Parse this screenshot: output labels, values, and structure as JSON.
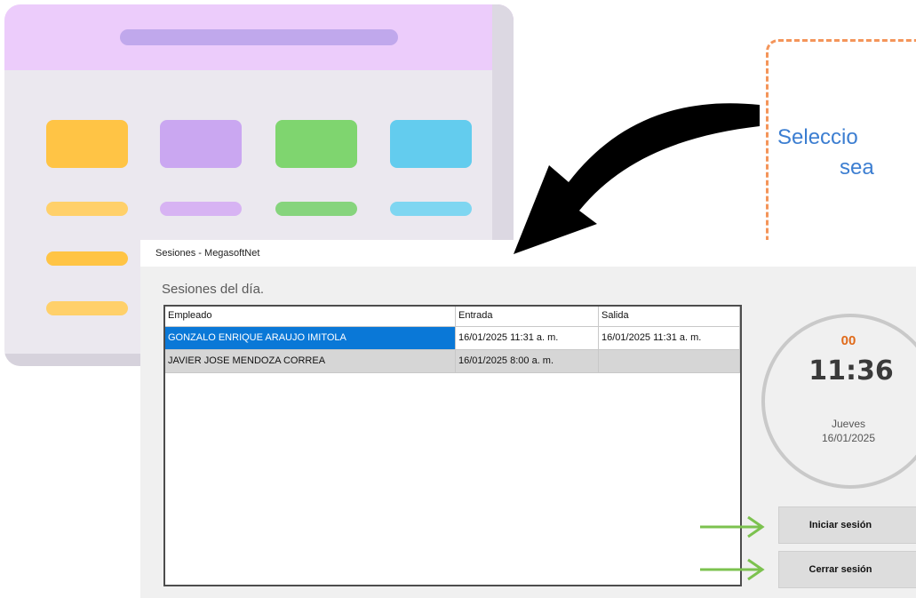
{
  "illustration": {
    "tile_colors": [
      "#ffc445",
      "#caa7f1",
      "#7fd56f",
      "#63ccee"
    ],
    "pill_colors": [
      "#ffd06a",
      "#d7b3f3",
      "#86d47d",
      "#7fd6f1"
    ],
    "accent": "#c0a8ec"
  },
  "callout": {
    "line1": "Seleccio",
    "line2": "sea",
    "border_color": "#f4955a",
    "text_color": "#3c7ed1"
  },
  "window": {
    "title": "Sesiones - MegasoftNet",
    "heading": "Sesiones del día."
  },
  "table": {
    "columns": [
      "Empleado",
      "Entrada",
      "Salida"
    ],
    "rows": [
      {
        "empleado": "GONZALO ENRIQUE ARAUJO IMITOLA",
        "entrada": "16/01/2025 11:31 a. m.",
        "salida": "16/01/2025 11:31 a. m."
      },
      {
        "empleado": "JAVIER JOSE MENDOZA CORREA",
        "entrada": "16/01/2025 8:00 a. m.",
        "salida": ""
      }
    ],
    "selected_color": "#0a78d7"
  },
  "clock": {
    "seconds": "00",
    "time": "11:36",
    "day": "Jueves",
    "date": "16/01/2025"
  },
  "buttons": {
    "start": "Iniciar sesión",
    "end": "Cerrar sesión"
  },
  "icons": [
    "curved-arrow-icon",
    "green-arrow-icon"
  ]
}
